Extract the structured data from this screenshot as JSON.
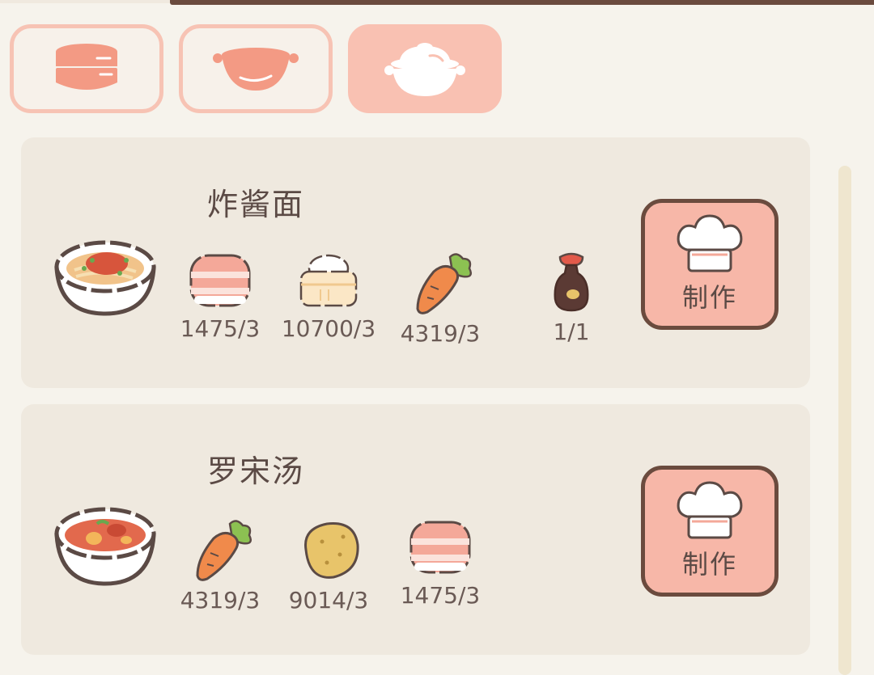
{
  "tabs": [
    {
      "name": "steamer-icon",
      "active": false
    },
    {
      "name": "pot-icon",
      "active": false
    },
    {
      "name": "clay-pot-icon",
      "active": true
    }
  ],
  "recipes": [
    {
      "name": "炸酱面",
      "dish_icon": "noodle-bowl-icon",
      "ingredients": [
        {
          "icon": "bacon-icon",
          "count": "1475/3"
        },
        {
          "icon": "steamed-bun-icon",
          "count": "10700/3"
        },
        {
          "icon": "carrot-icon",
          "count": "4319/3"
        },
        {
          "icon": "soy-sauce-icon",
          "count": "1/1"
        }
      ],
      "button_label": "制作"
    },
    {
      "name": "罗宋汤",
      "dish_icon": "soup-bowl-icon",
      "ingredients": [
        {
          "icon": "carrot-icon",
          "count": "4319/3"
        },
        {
          "icon": "potato-icon",
          "count": "9014/3"
        },
        {
          "icon": "bacon-icon",
          "count": "1475/3"
        }
      ],
      "button_label": "制作"
    }
  ],
  "colors": {
    "background": "#f6f3ec",
    "card": "#efe9df",
    "accent": "#f7b7a8",
    "border": "#6b4b3e"
  }
}
